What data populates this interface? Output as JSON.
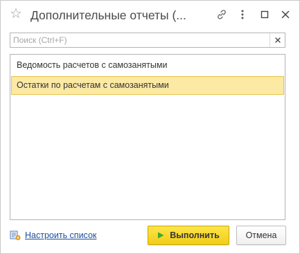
{
  "window": {
    "title": "Дополнительные отчеты (..."
  },
  "search": {
    "placeholder": "Поиск (Ctrl+F)",
    "value": ""
  },
  "list": {
    "items": [
      {
        "label": "Ведомость расчетов с самозанятыми",
        "selected": false
      },
      {
        "label": "Остатки по расчетам с самозанятыми",
        "selected": true
      }
    ]
  },
  "footer": {
    "customize_label": "Настроить список",
    "run_label": "Выполнить",
    "cancel_label": "Отмена"
  },
  "colors": {
    "selected_bg": "#fbe9a4",
    "selected_border": "#e9c44a",
    "primary_button": "#f5d52a",
    "link": "#1a4d99",
    "play_icon": "#3aaa35"
  },
  "icons": {
    "star": "star-icon",
    "link": "link-icon",
    "more": "more-vertical-icon",
    "maximize": "maximize-icon",
    "close": "close-icon",
    "clear": "clear-icon",
    "customize": "list-settings-icon",
    "run": "play-icon"
  }
}
